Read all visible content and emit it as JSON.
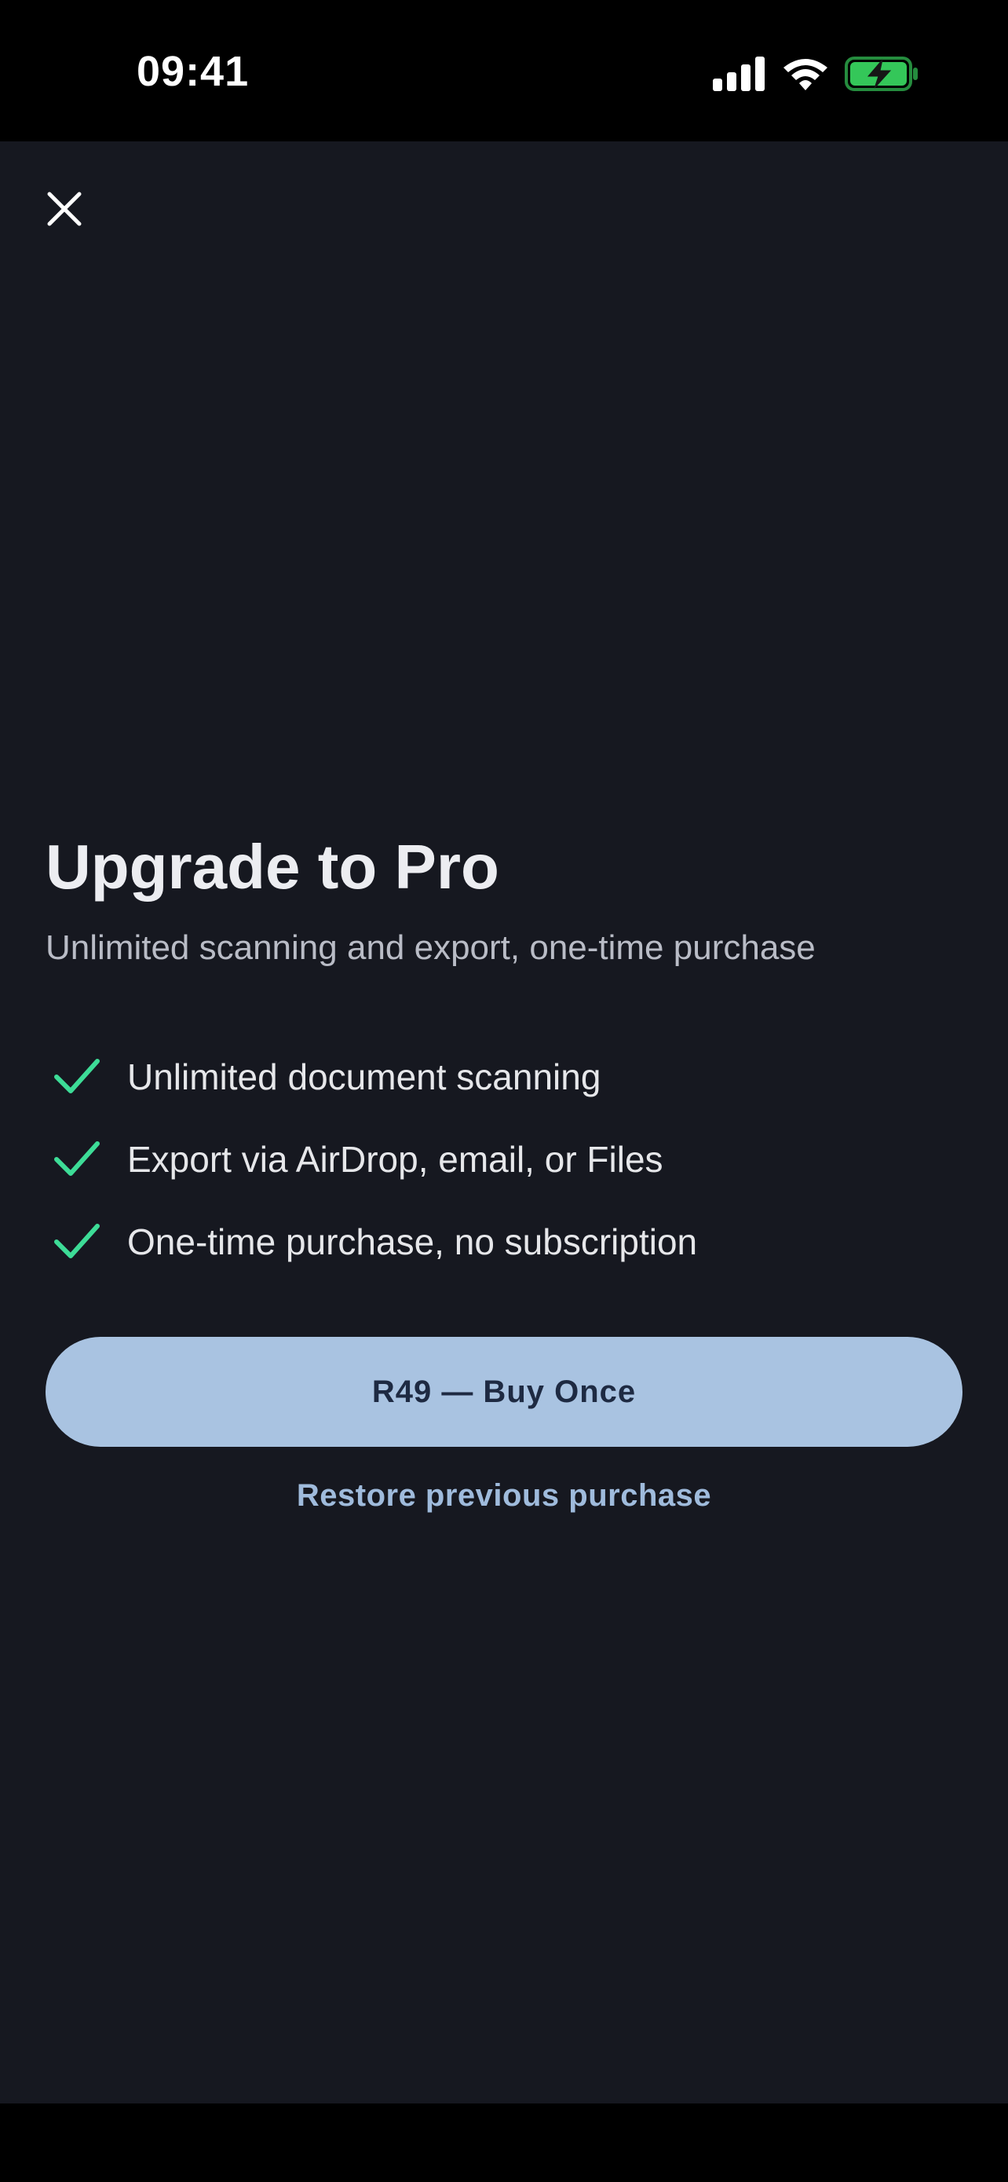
{
  "status_bar": {
    "time": "09:41",
    "icons": [
      "signal-icon",
      "wifi-icon",
      "battery-charging-icon"
    ],
    "battery_color": "#34c759"
  },
  "close_icon": "close-icon",
  "paywall": {
    "title": "Upgrade to Pro",
    "subtitle": "Unlimited scanning and export, one-time purchase",
    "features": [
      {
        "icon": "check-icon",
        "label": "Unlimited document scanning"
      },
      {
        "icon": "check-icon",
        "label": "Export via AirDrop, email, or Files"
      },
      {
        "icon": "check-icon",
        "label": "One-time purchase, no subscription"
      }
    ],
    "buy_label": "R49 — Buy Once",
    "restore_label": "Restore previous purchase"
  },
  "colors": {
    "background": "#161820",
    "accent": "#a9c3e1",
    "check": "#3ddc97",
    "link": "#9fbbdc"
  }
}
